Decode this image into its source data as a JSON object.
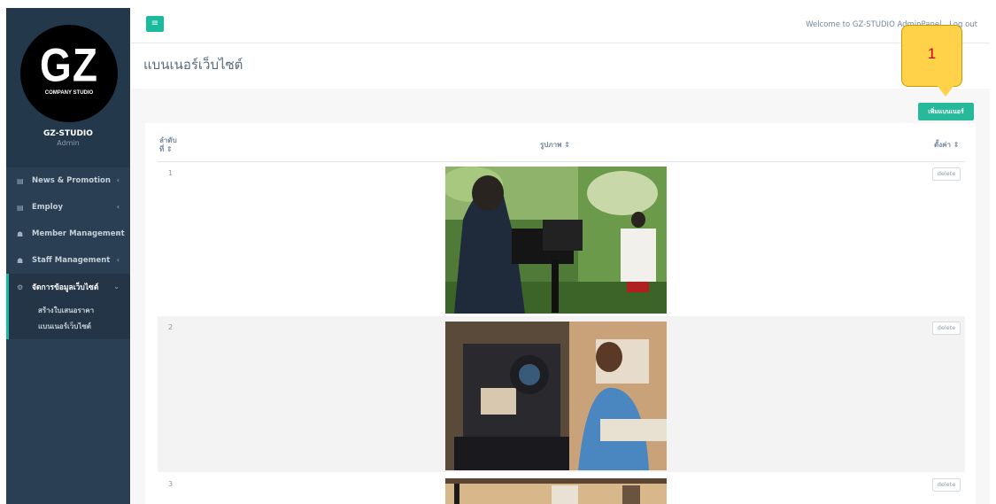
{
  "sidebar": {
    "logo_text": "GZ",
    "logo_subtext": "COMPANY STUDIO",
    "profile_name": "GZ-STUDIO",
    "profile_role": "Admin",
    "items": [
      {
        "label": "News & Promotion",
        "icon": "newspaper-icon"
      },
      {
        "label": "Employ",
        "icon": "newspaper-icon"
      },
      {
        "label": "Member Management",
        "icon": "users-icon"
      },
      {
        "label": "Staff Management",
        "icon": "users-icon"
      },
      {
        "label": "จัดการข้อมูลเว็บไซต์",
        "icon": "gears-icon"
      }
    ],
    "submenu": [
      "สร้างใบเสนอราคา",
      "แบนเนอร์เว็บไซต์"
    ]
  },
  "topnav": {
    "welcome": "Welcome to GZ-STUDIO AdminPanel",
    "logout": "Log out"
  },
  "page": {
    "title": "แบนเนอร์เว็บไซต์",
    "add_button": "เพิ่มแบนเนอร์"
  },
  "callout": {
    "number": "1"
  },
  "table": {
    "headers": {
      "order": "ลำดับ",
      "order_suffix": "ที่ ⇕",
      "image": "รูปภาพ ⇕",
      "settings": "ตั้งค่า ⇕"
    },
    "rows": [
      {
        "num": "1",
        "action": "delete"
      },
      {
        "num": "2",
        "action": "delete"
      },
      {
        "num": "3",
        "action": "delete"
      }
    ]
  },
  "colors": {
    "accent": "#1abb9c",
    "sidebar": "#2a3f54",
    "callout": "#ffd24a"
  }
}
